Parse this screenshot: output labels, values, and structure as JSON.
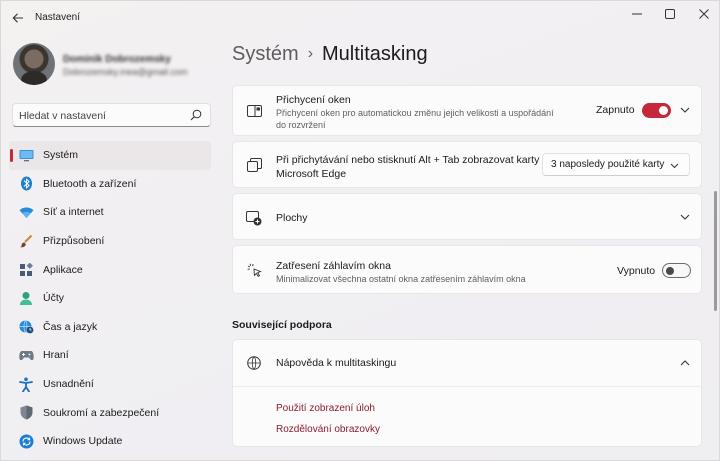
{
  "window": {
    "title": "Nastavení",
    "accent": "#c4283a"
  },
  "profile": {
    "name": "Dominik Dobrozemsky",
    "email": "Dobrozemsky.mea@gmail.com"
  },
  "search": {
    "placeholder": "Hledat v nastavení"
  },
  "sidebar": {
    "items": [
      {
        "label": "Systém",
        "icon": "monitor-icon",
        "active": true
      },
      {
        "label": "Bluetooth a zařízení",
        "icon": "bluetooth-icon"
      },
      {
        "label": "Síť a internet",
        "icon": "wifi-icon"
      },
      {
        "label": "Přizpůsobení",
        "icon": "brush-icon"
      },
      {
        "label": "Aplikace",
        "icon": "apps-icon"
      },
      {
        "label": "Účty",
        "icon": "person-icon"
      },
      {
        "label": "Čas a jazyk",
        "icon": "globe-clock-icon"
      },
      {
        "label": "Hraní",
        "icon": "gamepad-icon"
      },
      {
        "label": "Usnadnění",
        "icon": "accessibility-icon"
      },
      {
        "label": "Soukromí a zabezpečení",
        "icon": "shield-icon"
      },
      {
        "label": "Windows Update",
        "icon": "update-icon"
      }
    ]
  },
  "breadcrumb": {
    "parent": "Systém",
    "separator": "›",
    "current": "Multitasking"
  },
  "settings": {
    "snap": {
      "title": "Přichycení oken",
      "desc_line1": "Přichycení oken pro automatickou změnu jejich velikosti a uspořádání",
      "desc_line2": "do rozvržení",
      "toggle_label": "Zapnuto",
      "toggle_on": true
    },
    "alt_tab": {
      "title_line1": "Při přichytávání nebo stisknutí Alt + Tab zobrazovat karty",
      "title_line2": "Microsoft Edge",
      "dropdown_value": "3 naposledy použité karty"
    },
    "desktops": {
      "title": "Plochy"
    },
    "shake": {
      "title": "Zatřesení záhlavím okna",
      "desc": "Minimalizovat všechna ostatní okna zatřesením záhlavím okna",
      "toggle_label": "Vypnuto",
      "toggle_on": false
    }
  },
  "related": {
    "section_title": "Související podpora",
    "help_title": "Nápověda k multitaskingu",
    "links": [
      "Použití zobrazení úloh",
      "Rozdělování obrazovky"
    ]
  }
}
